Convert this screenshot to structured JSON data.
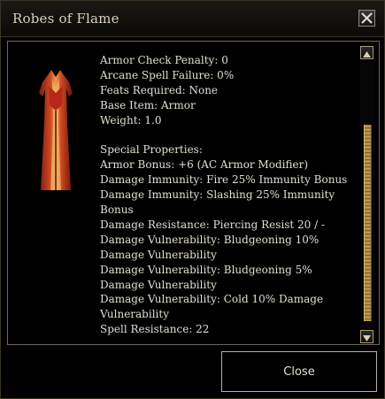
{
  "window": {
    "title": "Robes of Flame"
  },
  "item": {
    "portrait_icon": "robe-icon",
    "basic_lines": [
      "Armor Check Penalty: 0",
      "Arcane Spell Failure: 0%",
      "Feats Required: None",
      "Base Item: Armor",
      "Weight: 1.0"
    ],
    "special_lines": [
      "Special Properties:",
      "Armor Bonus: +6 (AC Armor Modifier)",
      "Damage Immunity: Fire 25% Immunity Bonus",
      "Damage Immunity: Slashing 25% Immunity",
      "Bonus",
      "Damage Resistance: Piercing Resist 20 / -",
      "Damage Vulnerability: Bludgeoning 10%",
      "Damage Vulnerability",
      "Damage Vulnerability: Bludgeoning 5%",
      "Damage Vulnerability",
      "Damage Vulnerability: Cold 10% Damage",
      "Vulnerability",
      "Spell Resistance: 22"
    ]
  },
  "buttons": {
    "close_label": "Close"
  },
  "colors": {
    "text": "#e2ddcf",
    "border": "#b8b0a0",
    "scroll_thumb": "#c8a45a"
  }
}
